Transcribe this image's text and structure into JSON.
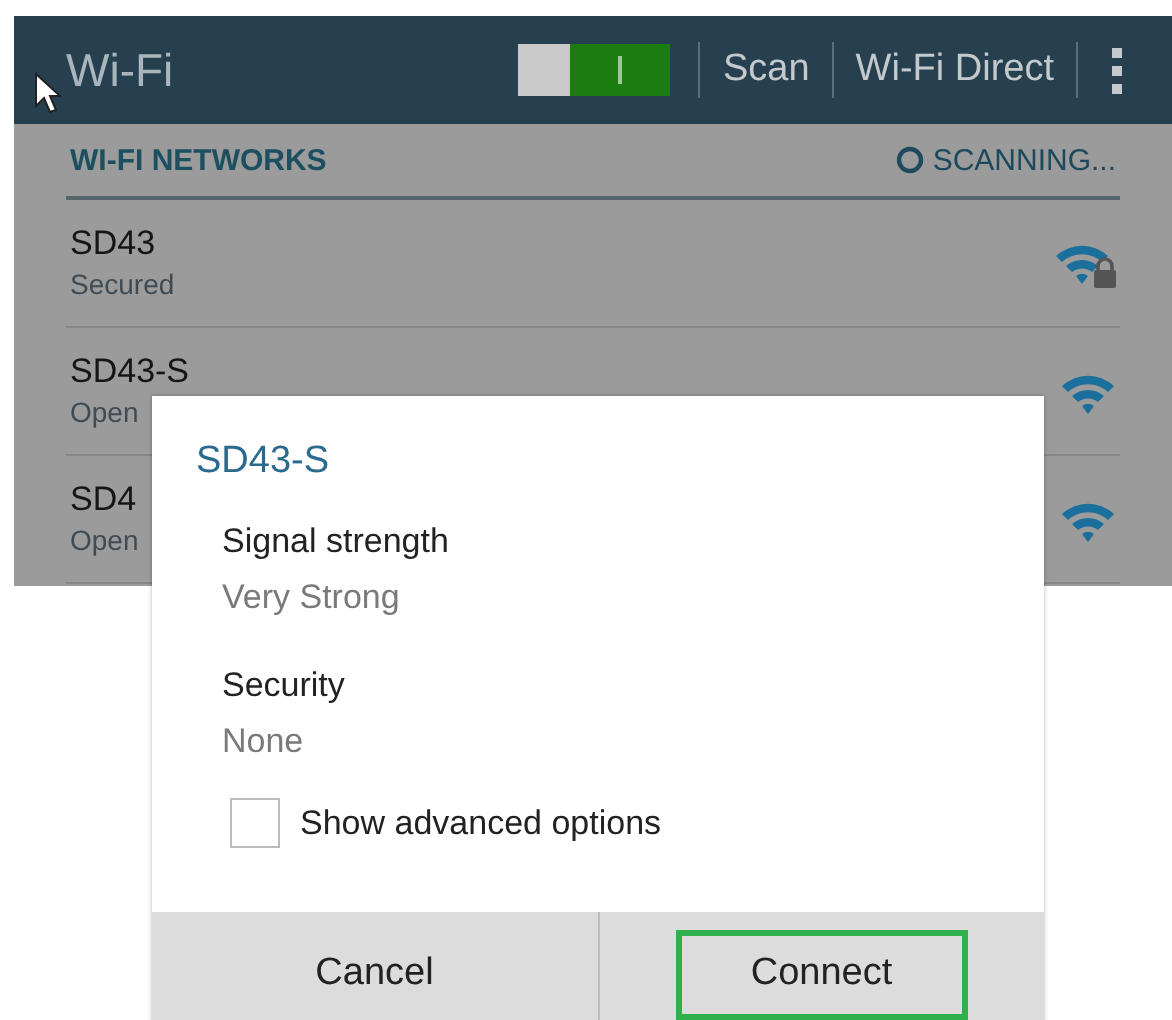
{
  "top_bar": {
    "title": "Wi-Fi",
    "wifi_switch": {
      "on": true
    },
    "actions": [
      "Scan",
      "Wi-Fi Direct"
    ]
  },
  "section": {
    "title": "WI-FI NETWORKS",
    "status": "SCANNING..."
  },
  "networks": [
    {
      "name": "SD43",
      "status": "Secured",
      "secured": true
    },
    {
      "name": "SD43-S",
      "status": "Open",
      "secured": false
    },
    {
      "name": "SD4",
      "status": "Open",
      "secured": false
    }
  ],
  "dialog": {
    "title": "SD43-S",
    "fields": [
      {
        "label": "Signal strength",
        "value": "Very Strong"
      },
      {
        "label": "Security",
        "value": "None"
      }
    ],
    "advanced_option": {
      "label": "Show advanced options",
      "checked": false
    },
    "buttons": [
      {
        "label": "Cancel",
        "focused": false
      },
      {
        "label": "Connect",
        "focused": true
      }
    ]
  }
}
